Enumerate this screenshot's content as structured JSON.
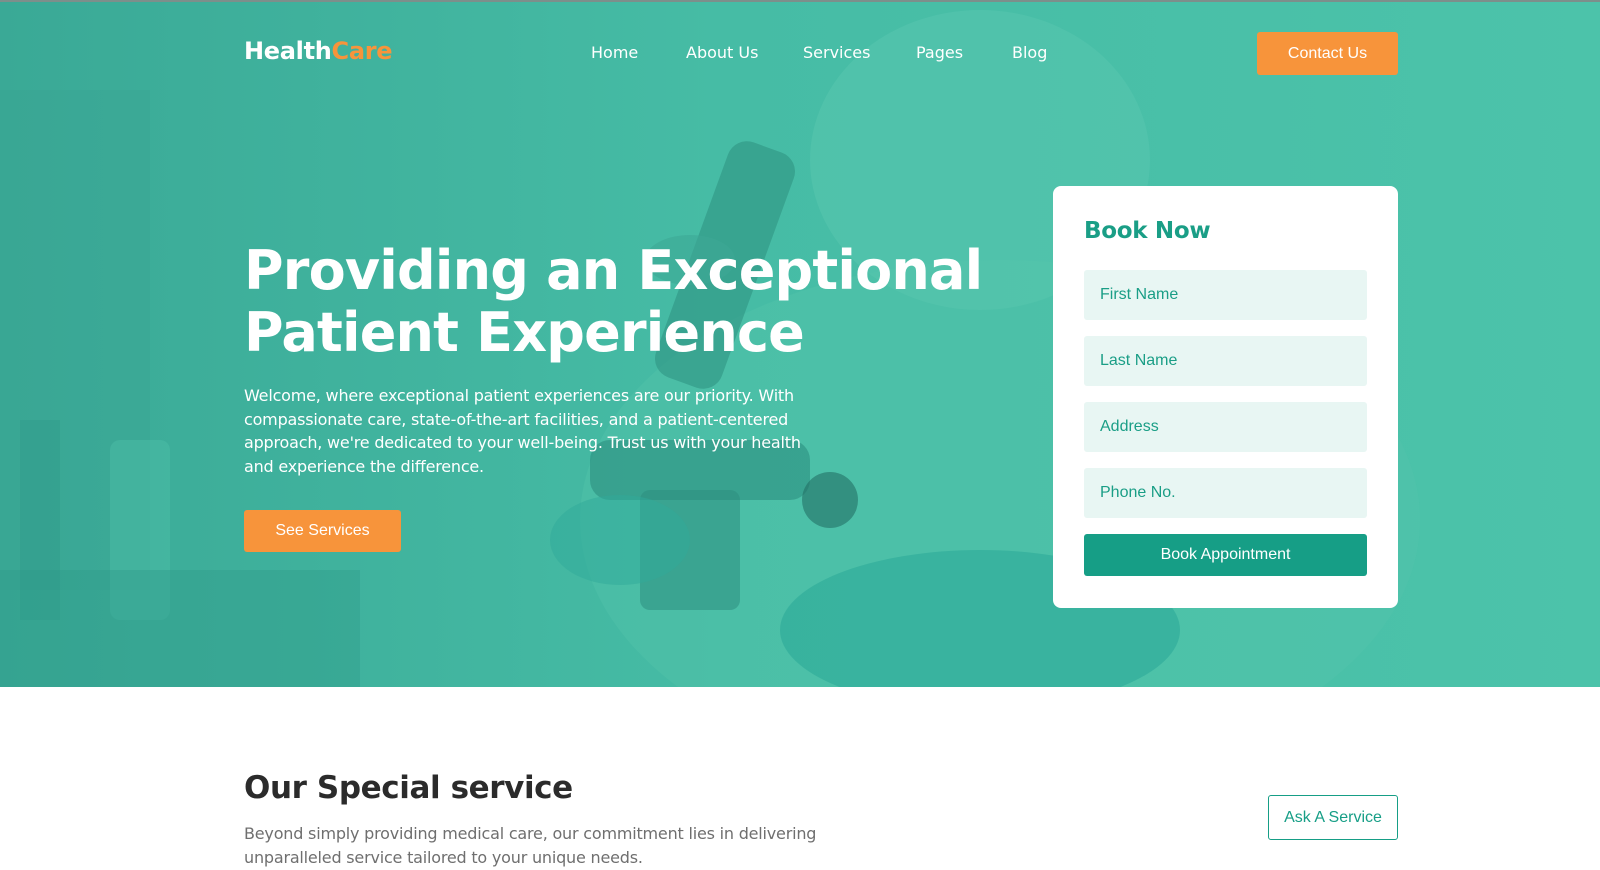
{
  "brand": {
    "part1": "Health",
    "part2": "Care"
  },
  "nav": {
    "items": [
      "Home",
      "About Us",
      "Services",
      "Pages",
      "Blog"
    ],
    "contact_label": "Contact Us"
  },
  "hero": {
    "title_line1": "Providing an Exceptional",
    "title_line2": "Patient Experience",
    "description": "Welcome, where exceptional patient experiences are our priority. With compassionate care, state-of-the-art facilities, and a patient-centered approach, we're dedicated to your well-being. Trust us with your health and experience the difference.",
    "cta_label": "See Services"
  },
  "booking": {
    "title": "Book Now",
    "fields": [
      {
        "placeholder": "First Name"
      },
      {
        "placeholder": "Last Name"
      },
      {
        "placeholder": "Address"
      },
      {
        "placeholder": "Phone No."
      }
    ],
    "submit_label": "Book Appointment"
  },
  "services": {
    "title": "Our Special service",
    "description": "Beyond simply providing medical care, our commitment lies in delivering unparalleled service tailored to your unique needs.",
    "ask_label": "Ask A Service"
  },
  "colors": {
    "hero_teal": "#45bda4",
    "accent_orange": "#f7943b",
    "primary_green": "#169e86",
    "input_bg": "#e8f6f3"
  }
}
